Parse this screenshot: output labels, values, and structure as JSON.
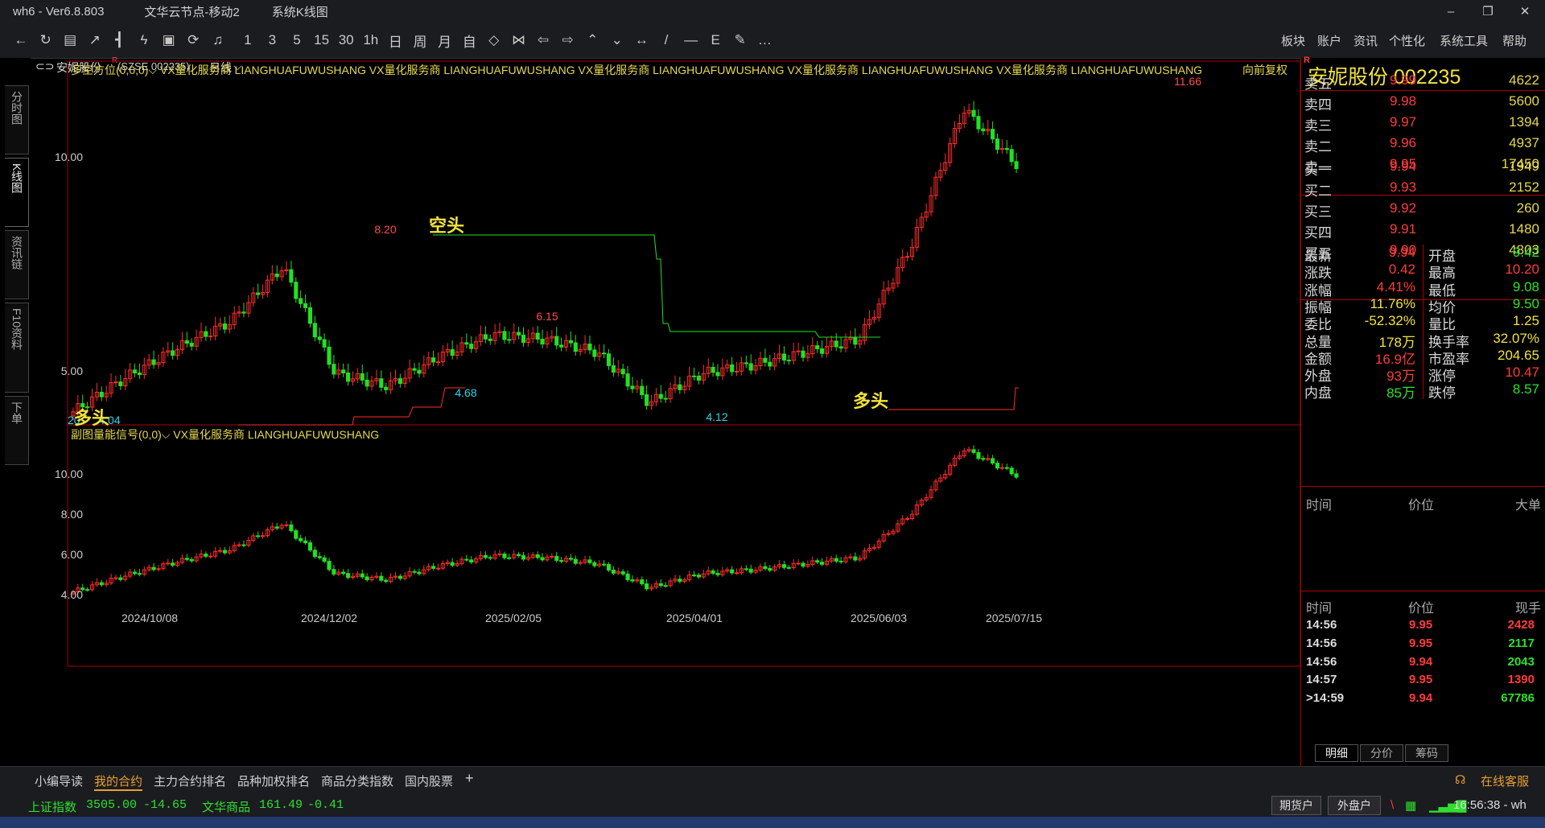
{
  "window": {
    "app": "wh6 - Ver6.8.803",
    "server": "文华云节点-移动2",
    "view": "系统K线图",
    "min": "–",
    "max": "❐",
    "close": "✕"
  },
  "toolbar_right": [
    "板块",
    "账户",
    "资讯",
    "个性化",
    "系统工具",
    "帮助"
  ],
  "toolbar_glyphs": [
    "←",
    "↻",
    "▤",
    "↗",
    "┫",
    "ϟ",
    "▣",
    "⟳",
    "♫",
    "1",
    "3",
    "5",
    "15",
    "30",
    "1h",
    "日",
    "周",
    "月",
    "自",
    "◇",
    "⋈",
    "⇦",
    "⇨",
    "⌃",
    "⌄",
    "↔",
    "/",
    "—",
    "E",
    "✎",
    "…"
  ],
  "side_tabs": [
    "分时图",
    "K线图",
    "资讯链",
    "F10资料",
    "下单"
  ],
  "chart_header": {
    "stock": "安妮股份",
    "code_box": "(SZSE  002235)",
    "period": "日线",
    "adjust": "向前复权"
  },
  "main_formula": "多空方位(0,0,0)⌵  VX量化服务商  LIANGHUAFUWUSHANG  VX量化服务商  LIANGHUAFUWUSHANG  VX量化服务商  LIANGHUAFUWUSHANG  VX量化服务商  LIANGHUAFUWUSHANG  VX量化服务商  LIANGHUAFUWUSHANG",
  "sub_formula": "副图量能信号(0,0)⌵  VX量化服务商  LIANGHUAFUWUSHANG",
  "chart_labels": {
    "bear": "空头",
    "bull": "多头",
    "bull2": "多头",
    "p820": "8.20",
    "p615": "6.15",
    "p1166": "11.66",
    "p468": "4.68",
    "p412": "4.12",
    "p404": "4.04",
    "p20": "20",
    "y_main_10": "10.00",
    "y_main_5": "5.00",
    "y_sub_10": "10.00",
    "y_sub_8": "8.00",
    "y_sub_6": "6.00",
    "y_sub_4": "4.00"
  },
  "chart_data": {
    "type": "line",
    "title": "安妮股份 002235 日线",
    "x_dates": [
      "2024/10/08",
      "2024/12/02",
      "2025/02/05",
      "2025/04/01",
      "2025/06/03",
      "2025/07/15"
    ],
    "series": [
      {
        "name": "安妮股份",
        "approx_close": [
          4.1,
          4.9,
          5.6,
          6.2,
          7.5,
          5.0,
          4.7,
          5.4,
          5.9,
          5.8,
          5.5,
          4.3,
          5.0,
          5.2,
          5.5,
          5.8,
          8.0,
          11.2,
          9.9
        ]
      }
    ],
    "annotated_values": {
      "high_1": 8.2,
      "high_2": 6.15,
      "high_3": 11.66,
      "low_1": 4.68,
      "low_2": 4.12,
      "low_3": 4.04
    },
    "ylim": [
      4.0,
      12.0
    ]
  },
  "quote": {
    "title": "安妮股份  002235",
    "asks": [
      {
        "l": "卖五",
        "p": "9.99",
        "v": "4622"
      },
      {
        "l": "卖四",
        "p": "9.98",
        "v": "5600"
      },
      {
        "l": "卖三",
        "p": "9.97",
        "v": "1394"
      },
      {
        "l": "卖二",
        "p": "9.96",
        "v": "4937"
      },
      {
        "l": "卖一",
        "p": "9.95",
        "v": "17450"
      }
    ],
    "bids": [
      {
        "l": "买一",
        "p": "9.94",
        "v": "1949"
      },
      {
        "l": "买二",
        "p": "9.93",
        "v": "2152"
      },
      {
        "l": "买三",
        "p": "9.92",
        "v": "260"
      },
      {
        "l": "买四",
        "p": "9.91",
        "v": "1480"
      },
      {
        "l": "买五",
        "p": "9.90",
        "v": "4803"
      }
    ],
    "stats_left": [
      {
        "l": "最新",
        "v": "9.94",
        "c": "#ff3b3b"
      },
      {
        "l": "涨跌",
        "v": "0.42",
        "c": "#ff3b3b"
      },
      {
        "l": "涨幅",
        "v": "4.41%",
        "c": "#ff3b3b"
      },
      {
        "l": "振幅",
        "v": "11.76%",
        "c": "#f2e33a"
      },
      {
        "l": "委比",
        "v": "-52.32%",
        "c": "#f2e33a"
      },
      {
        "l": "总量",
        "v": "178万",
        "c": "#f2e33a"
      },
      {
        "l": "金额",
        "v": "16.9亿",
        "c": "#ff3b3b"
      },
      {
        "l": "外盘",
        "v": "93万",
        "c": "#ff3b3b"
      },
      {
        "l": "内盘",
        "v": "85万",
        "c": "#2ee02e"
      }
    ],
    "stats_right": [
      {
        "l": "开盘",
        "v": "9.42",
        "c": "#2ee02e"
      },
      {
        "l": "最高",
        "v": "10.20",
        "c": "#ff3b3b"
      },
      {
        "l": "最低",
        "v": "9.08",
        "c": "#2ee02e"
      },
      {
        "l": "均价",
        "v": "9.50",
        "c": "#2ee02e"
      },
      {
        "l": "量比",
        "v": "1.25",
        "c": "#f2e33a"
      },
      {
        "l": "换手率",
        "v": "32.07%",
        "c": "#f2e33a"
      },
      {
        "l": "市盈率",
        "v": "204.65",
        "c": "#f2e33a"
      },
      {
        "l": "涨停",
        "v": "10.47",
        "c": "#ff3b3b"
      },
      {
        "l": "跌停",
        "v": "8.57",
        "c": "#2ee02e"
      }
    ],
    "big_header": {
      "t": "时间",
      "p": "价位",
      "v": "大单"
    },
    "tick_header": {
      "t": "时间",
      "p": "价位",
      "v": "现手"
    },
    "ticks": [
      {
        "t": "14:56",
        "p": "9.95",
        "v": "2428",
        "c": "#ff3b3b"
      },
      {
        "t": "14:56",
        "p": "9.95",
        "v": "2117",
        "c": "#2ee02e"
      },
      {
        "t": "14:56",
        "p": "9.94",
        "v": "2043",
        "c": "#2ee02e"
      },
      {
        "t": "14:57",
        "p": "9.95",
        "v": "1390",
        "c": "#ff3b3b"
      },
      {
        "t": ">14:59",
        "p": "9.94",
        "v": "67786",
        "c": "#2ee02e"
      }
    ],
    "tabs": [
      "明细",
      "分价",
      "筹码"
    ]
  },
  "footer_tabs": [
    "小编导读",
    "我的合约",
    "主力合约排名",
    "品种加权排名",
    "商品分类指数",
    "国内股票",
    "+"
  ],
  "service": "在线客服",
  "status": {
    "idx1_name": "上证指数",
    "idx1_val": "3505.00",
    "idx1_chg": "-14.65",
    "idx2_name": "文华商品",
    "idx2_val": "161.49",
    "idx2_chg": "-0.41",
    "btn1": "期货户",
    "btn2": "外盘户",
    "clock": "16:56:38 - wh"
  }
}
